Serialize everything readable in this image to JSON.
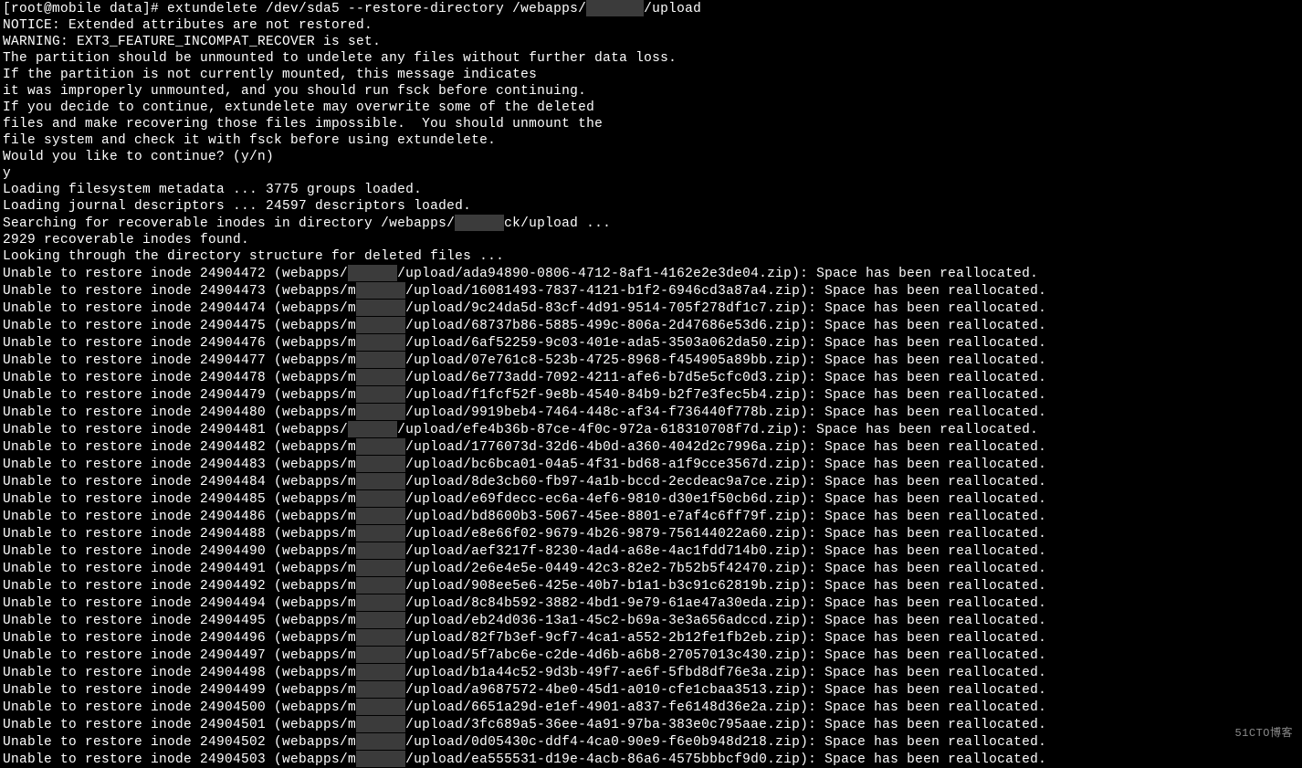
{
  "prompt": {
    "prefix": "[root@mobile data]# ",
    "cmd_a": "extundelete /dev/sda5 --restore-directory /webapps/",
    "cmd_b": "/upload"
  },
  "redacted": "      ",
  "redacted_wide": "       ",
  "redacted_preamble": "ck",
  "preamble": [
    "NOTICE: Extended attributes are not restored.",
    "WARNING: EXT3_FEATURE_INCOMPAT_RECOVER is set.",
    "The partition should be unmounted to undelete any files without further data loss.",
    "If the partition is not currently mounted, this message indicates",
    "it was improperly unmounted, and you should run fsck before continuing.",
    "If you decide to continue, extundelete may overwrite some of the deleted",
    "files and make recovering those files impossible.  You should unmount the",
    "file system and check it with fsck before using extundelete.",
    "Would you like to continue? (y/n)",
    "y",
    "Loading filesystem metadata ... 3775 groups loaded.",
    "Loading journal descriptors ... 24597 descriptors loaded."
  ],
  "searching_a": "Searching for recoverable inodes in directory /webapps/",
  "searching_b": "/upload ...",
  "found": "2929 recoverable inodes found.",
  "looking": "Looking through the directory structure for deleted files ...",
  "unable_prefix_a": "Unable to restore inode ",
  "unable_prefix_b": " (webapps/m",
  "unable_prefix_b_first": " (webapps/",
  "upload_seg": "/upload/",
  "unable_suffix": ".zip): Space has been reallocated.",
  "items": [
    {
      "inode": "24904472",
      "file": "ada94890-0806-4712-8af1-4162e2e3de04",
      "first": true
    },
    {
      "inode": "24904473",
      "file": "16081493-7837-4121-b1f2-6946cd3a87a4"
    },
    {
      "inode": "24904474",
      "file": "9c24da5d-83cf-4d91-9514-705f278df1c7"
    },
    {
      "inode": "24904475",
      "file": "68737b86-5885-499c-806a-2d47686e53d6"
    },
    {
      "inode": "24904476",
      "file": "6af52259-9c03-401e-ada5-3503a062da50"
    },
    {
      "inode": "24904477",
      "file": "07e761c8-523b-4725-8968-f454905a89bb"
    },
    {
      "inode": "24904478",
      "file": "6e773add-7092-4211-afe6-b7d5e5cfc0d3"
    },
    {
      "inode": "24904479",
      "file": "f1fcf52f-9e8b-4540-84b9-b2f7e3fec5b4"
    },
    {
      "inode": "24904480",
      "file": "9919beb4-7464-448c-af34-f736440f778b"
    },
    {
      "inode": "24904481",
      "file": "efe4b36b-87ce-4f0c-972a-618310708f7d",
      "first": true
    },
    {
      "inode": "24904482",
      "file": "1776073d-32d6-4b0d-a360-4042d2c7996a"
    },
    {
      "inode": "24904483",
      "file": "bc6bca01-04a5-4f31-bd68-a1f9cce3567d"
    },
    {
      "inode": "24904484",
      "file": "8de3cb60-fb97-4a1b-bccd-2ecdeac9a7ce"
    },
    {
      "inode": "24904485",
      "file": "e69fdecc-ec6a-4ef6-9810-d30e1f50cb6d"
    },
    {
      "inode": "24904486",
      "file": "bd8600b3-5067-45ee-8801-e7af4c6ff79f"
    },
    {
      "inode": "24904488",
      "file": "e8e66f02-9679-4b26-9879-756144022a60"
    },
    {
      "inode": "24904490",
      "file": "aef3217f-8230-4ad4-a68e-4ac1fdd714b0"
    },
    {
      "inode": "24904491",
      "file": "2e6e4e5e-0449-42c3-82e2-7b52b5f42470"
    },
    {
      "inode": "24904492",
      "file": "908ee5e6-425e-40b7-b1a1-b3c91c62819b"
    },
    {
      "inode": "24904494",
      "file": "8c84b592-3882-4bd1-9e79-61ae47a30eda"
    },
    {
      "inode": "24904495",
      "file": "eb24d036-13a1-45c2-b69a-3e3a656adccd"
    },
    {
      "inode": "24904496",
      "file": "82f7b3ef-9cf7-4ca1-a552-2b12fe1fb2eb"
    },
    {
      "inode": "24904497",
      "file": "5f7abc6e-c2de-4d6b-a6b8-27057013c430"
    },
    {
      "inode": "24904498",
      "file": "b1a44c52-9d3b-49f7-ae6f-5fbd8df76e3a"
    },
    {
      "inode": "24904499",
      "file": "a9687572-4be0-45d1-a010-cfe1cbaa3513"
    },
    {
      "inode": "24904500",
      "file": "6651a29d-e1ef-4901-a837-fe6148d36e2a"
    },
    {
      "inode": "24904501",
      "file": "3fc689a5-36ee-4a91-97ba-383e0c795aae"
    },
    {
      "inode": "24904502",
      "file": "0d05430c-ddf4-4ca0-90e9-f6e0b948d218"
    },
    {
      "inode": "24904503",
      "file": "ea555531-d19e-4acb-86a6-4575bbbcf9d0"
    }
  ],
  "watermark": "51CTO博客"
}
